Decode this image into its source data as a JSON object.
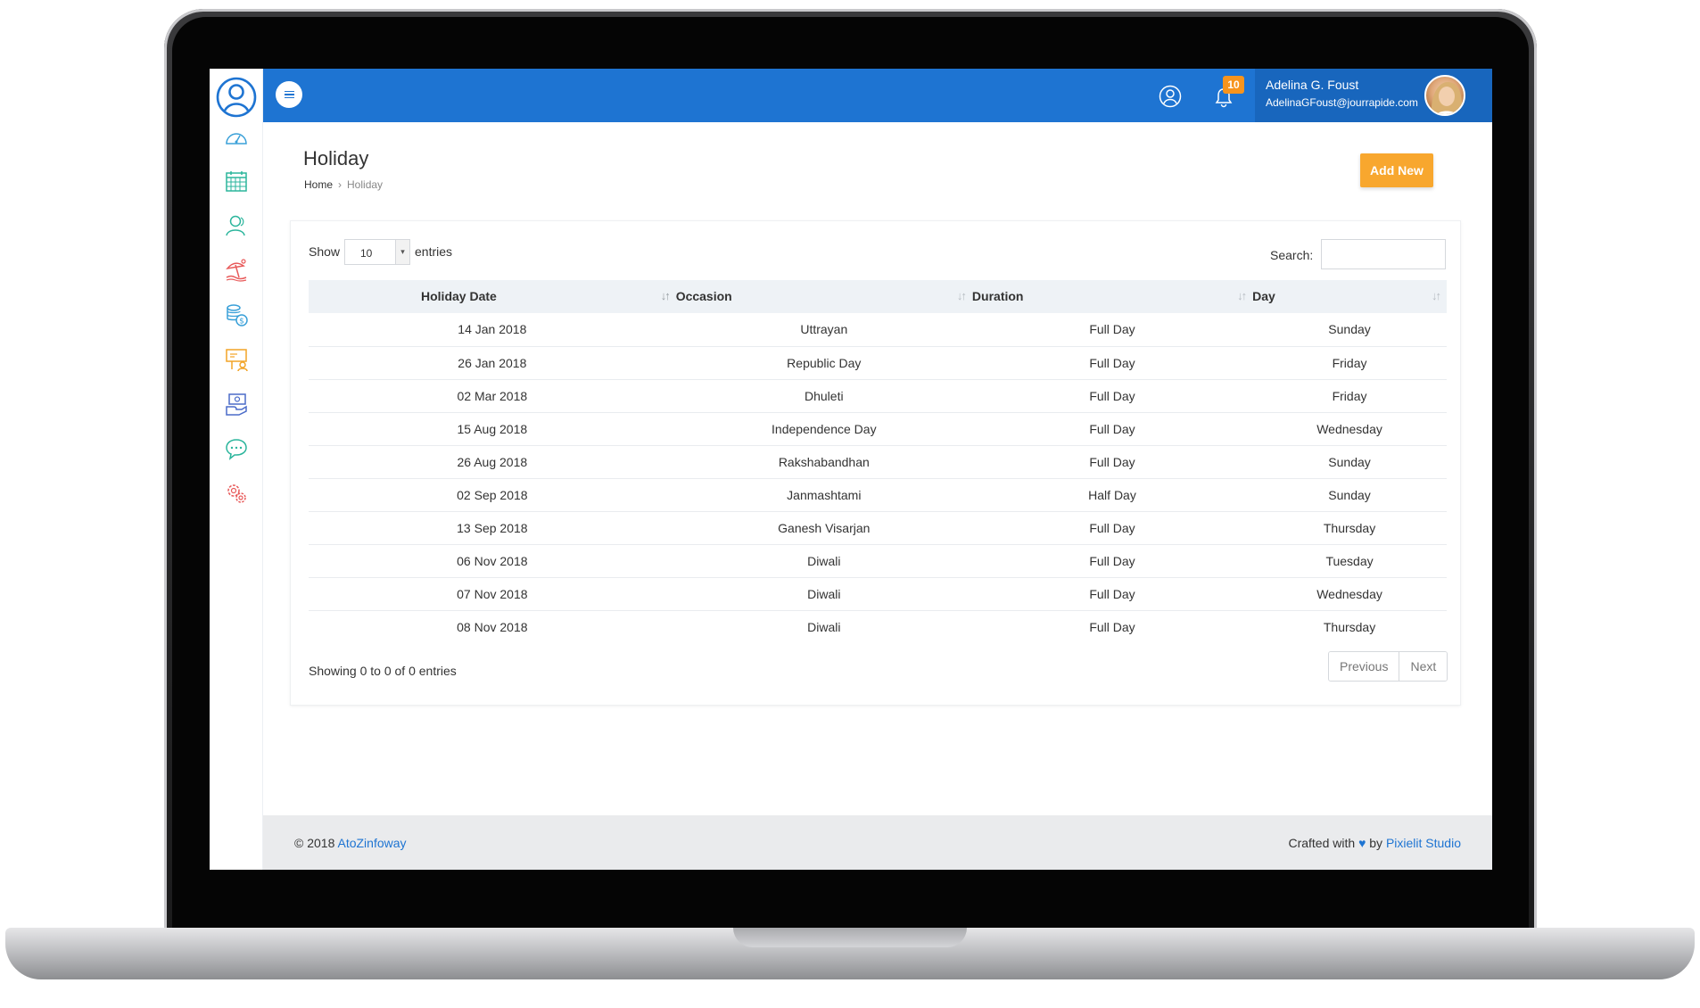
{
  "sidebar": {
    "items": [
      {
        "icon": "dashboard-gauge-icon",
        "color": "#3aa0d8"
      },
      {
        "icon": "calendar-icon",
        "color": "#2bb59c"
      },
      {
        "icon": "users-icon",
        "color": "#2bb59c"
      },
      {
        "icon": "holiday-beach-icon",
        "color": "#e85a5a"
      },
      {
        "icon": "money-coins-icon",
        "color": "#3aa0d8"
      },
      {
        "icon": "presentation-icon",
        "color": "#f2a427"
      },
      {
        "icon": "payment-hand-icon",
        "color": "#4b6cc9"
      },
      {
        "icon": "chat-bubble-icon",
        "color": "#2bb59c"
      },
      {
        "icon": "settings-gears-icon",
        "color": "#e85a5a"
      }
    ]
  },
  "topbar": {
    "accent": "#1e74d2",
    "notifications_count": "10",
    "user_name": "Adelina G. Foust",
    "user_email": "AdelinaGFoust@jourrapide.com"
  },
  "page": {
    "title": "Holiday",
    "breadcrumb": {
      "home": "Home",
      "current": "Holiday"
    },
    "add_new_label": "Add New"
  },
  "table_controls": {
    "show_label": "Show",
    "entries_value": "10",
    "entries_label": "entries",
    "search_label": "Search:",
    "search_value": ""
  },
  "table": {
    "columns": [
      "Holiday Date",
      "Occasion",
      "Duration",
      "Day"
    ],
    "rows": [
      [
        "14 Jan 2018",
        "Uttrayan",
        "Full Day",
        "Sunday"
      ],
      [
        "26 Jan 2018",
        "Republic Day",
        "Full Day",
        "Friday"
      ],
      [
        "02 Mar 2018",
        "Dhuleti",
        "Full Day",
        "Friday"
      ],
      [
        "15 Aug 2018",
        "Independence Day",
        "Full Day",
        "Wednesday"
      ],
      [
        "26 Aug 2018",
        "Rakshabandhan",
        "Full Day",
        "Sunday"
      ],
      [
        "02 Sep 2018",
        "Janmashtami",
        "Half Day",
        "Sunday"
      ],
      [
        "13 Sep 2018",
        "Ganesh Visarjan",
        "Full Day",
        "Thursday"
      ],
      [
        "06 Nov 2018",
        "Diwali",
        "Full Day",
        "Tuesday"
      ],
      [
        "07 Nov 2018",
        "Diwali",
        "Full Day",
        "Wednesday"
      ],
      [
        "08 Nov 2018",
        "Diwali",
        "Full Day",
        "Thursday"
      ]
    ],
    "info": "Showing 0 to 0 of 0 entries",
    "previous_label": "Previous",
    "next_label": "Next"
  },
  "footer": {
    "copyright": "© 2018",
    "company": "AtoZinfoway",
    "crafted_prefix": "Crafted with",
    "crafted_by": "by",
    "studio": "Pixielit Studio"
  }
}
